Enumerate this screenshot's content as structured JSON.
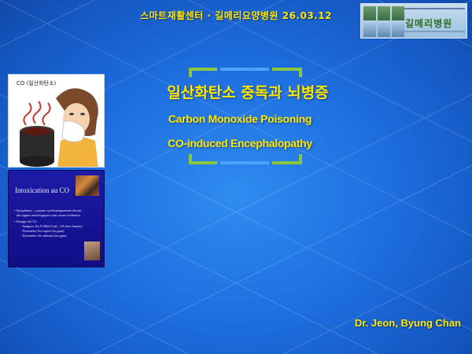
{
  "header": {
    "text": "스마트재활센터 · 길메리요양병원 26.03.12",
    "logo_name": "길메리병원"
  },
  "title": {
    "korean": "일산화탄소 중독과 뇌병증",
    "english_line1": "Carbon Monoxide Poisoning",
    "english_line2": "CO-induced Encephalopathy"
  },
  "author": "Dr. Jeon, Byung Chan",
  "images": {
    "cartoon": {
      "label": "CO (일산화탄소)",
      "description_icon": "co-cartoon-image"
    },
    "french_slide": {
      "title": "Intoxication au CO",
      "bullets": [
        {
          "text": "• Symptômes : y penser systématiquement devant",
          "indent": false
        },
        {
          "text": "des signes neurologiques sans causes évidentes.",
          "indent": false
        },
        {
          "text": "• Dosage du CO :",
          "indent": false
        },
        {
          "text": "- Sanguin: En % HbCO (nl, <10 chez fumeur)",
          "indent": true
        },
        {
          "text": "- Dosimètre Air expiré (en ppm)",
          "indent": true
        },
        {
          "text": "- Dosimètre Air ambiant (en ppm)",
          "indent": true
        }
      ]
    }
  },
  "colors": {
    "accent_yellow": "#ffe600",
    "bracket_green": "#8cc63e",
    "bracket_blue": "#4aa3ff",
    "background": "#1e6fe0"
  }
}
